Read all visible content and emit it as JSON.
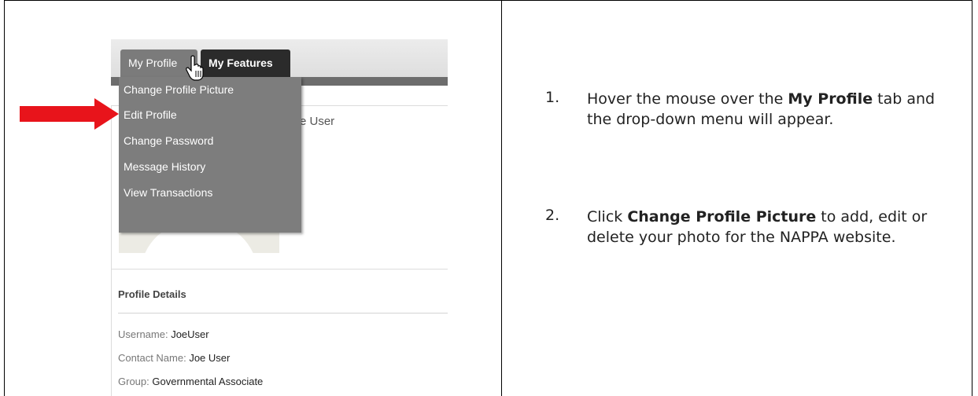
{
  "tabs": {
    "my_profile": "My Profile",
    "my_features": "My Features"
  },
  "dropdown": {
    "items": [
      "Change Profile Picture",
      "Edit Profile",
      "Change Password",
      "Message History",
      "View Transactions"
    ]
  },
  "profile": {
    "partial_name": "e User"
  },
  "details": {
    "title": "Profile Details",
    "rows": [
      {
        "label": "Username:",
        "value": "JoeUser"
      },
      {
        "label": "Contact Name:",
        "value": "Joe User"
      },
      {
        "label": "Group:",
        "value": "Governmental Associate"
      }
    ]
  },
  "instructions": {
    "step1": {
      "num": "1.",
      "pre": "Hover the mouse over the ",
      "bold": "My Profile",
      "post": " tab and the drop-down menu will appear."
    },
    "step2": {
      "num": "2.",
      "pre": "Click ",
      "bold": "Change Profile Picture",
      "post": " to add, edit or delete your photo for the NAPPA website."
    }
  },
  "colors": {
    "arrow": "#e8141b",
    "menu_bg": "#7d7d7d",
    "tab_active": "#2b2b2b"
  }
}
